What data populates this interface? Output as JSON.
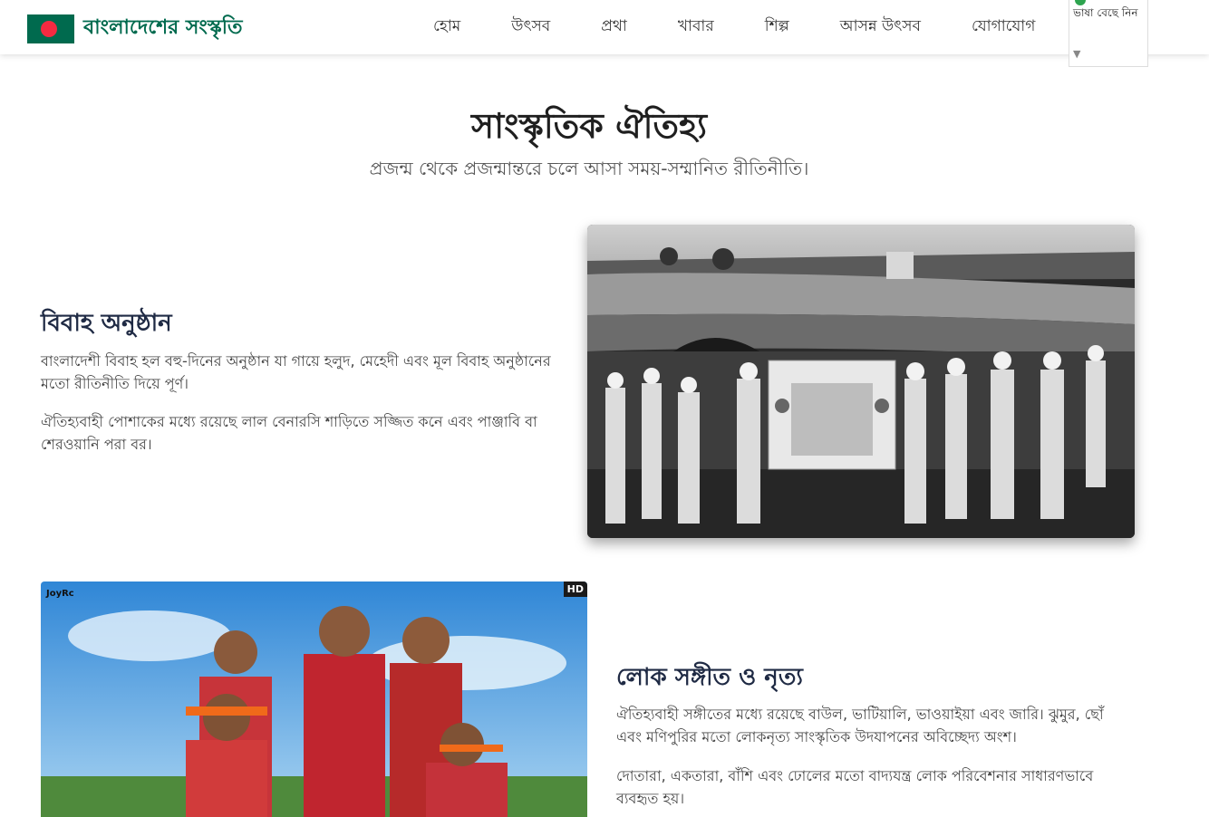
{
  "header": {
    "brand": "বাংলাদেশের সংস্কৃতি",
    "nav": [
      "হোম",
      "উৎসব",
      "প্রথা",
      "খাবার",
      "শিল্প",
      "আসন্ন উৎসব",
      "যোগাযোগ"
    ],
    "language_select_label": "ভাষা বেছে নিন"
  },
  "hero": {
    "title": "সাংস্কৃতিক ঐতিহ্য",
    "subtitle": "প্রজন্ম থেকে প্রজন্মান্তরে চলে আসা সময়-সম্মানিত রীতিনীতি।"
  },
  "sections": [
    {
      "heading": "বিবাহ অনুষ্ঠান",
      "paragraphs": [
        "বাংলাদেশী বিবাহ হল বহু-দিনের অনুষ্ঠান যা গায়ে হলুদ, মেহেদী এবং মূল বিবাহ অনুষ্ঠানের মতো রীতিনীতি দিয়ে পূর্ণ।",
        "ঐতিহ্যবাহী পোশাকের মধ্যে রয়েছে লাল বেনারসি শাড়িতে সজ্জিত কনে এবং পাঞ্জাবি বা শেরওয়ানি পরা বর।"
      ]
    },
    {
      "heading": "লোক সঙ্গীত ও নৃত্য",
      "paragraphs": [
        "ঐতিহ্যবাহী সঙ্গীতের মধ্যে রয়েছে বাউল, ভাটিয়ালি, ভাওয়াইয়া এবং জারি। ঝুমুর, ছোঁ এবং মণিপুরির মতো লোকনৃত্য সাংস্কৃতিক উদযাপনের অবিচ্ছেদ্য অংশ।",
        "দোতারা, একতারা, বাঁশি এবং ঢোলের মতো বাদ্যযন্ত্র লোক পরিবেশনার সাধারণভাবে ব্যবহৃত হয়।"
      ]
    }
  ],
  "image_badges": {
    "hd": "HD",
    "watermark": "JoyRc"
  },
  "colors": {
    "brand_green": "#006a4e",
    "flag_red": "#f42a41"
  }
}
